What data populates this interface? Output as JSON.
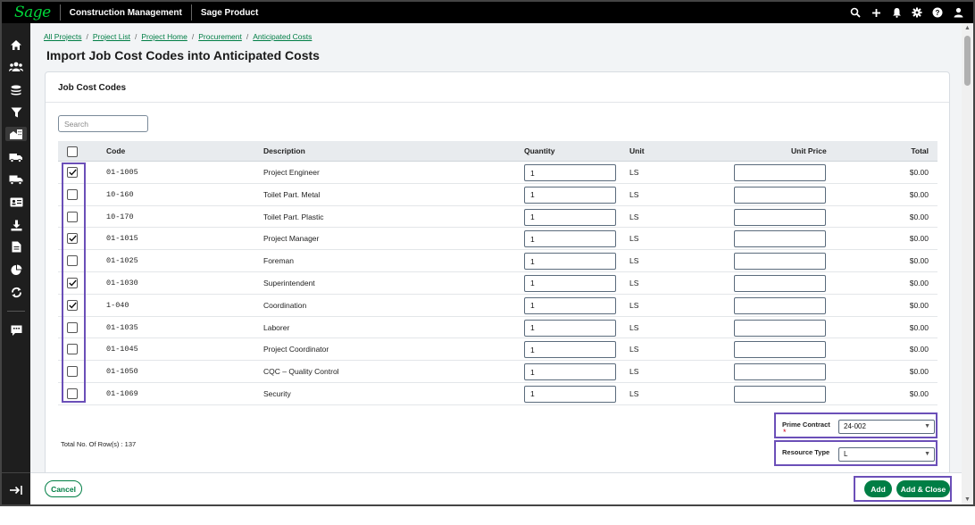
{
  "topbar": {
    "logo": "Sage",
    "app_name": "Construction Management",
    "product_name": "Sage Product",
    "icons": [
      "search-icon",
      "plus-icon",
      "bell-icon",
      "gear-icon",
      "help-icon",
      "user-icon"
    ]
  },
  "sidebar": {
    "icons": [
      "home-icon",
      "people-icon",
      "stack-icon",
      "filter-icon",
      "building-icon",
      "truck-dollar-icon",
      "truck-icon",
      "id-card-icon",
      "download-icon",
      "document-icon",
      "pie-chart-icon",
      "sync-icon",
      "feedback-icon"
    ],
    "active_index": 4
  },
  "breadcrumb": [
    "All Projects",
    "Project List",
    "Project Home",
    "Procurement",
    "Anticipated Costs"
  ],
  "page_title": "Import Job Cost Codes into Anticipated Costs",
  "card": {
    "title": "Job Cost Codes",
    "search_placeholder": "Search"
  },
  "table": {
    "columns": [
      "Code",
      "Description",
      "Quantity",
      "Unit",
      "Unit Price",
      "Total"
    ],
    "rows": [
      {
        "checked": true,
        "code": "01-1005",
        "description": "Project Engineer",
        "quantity": "1",
        "unit": "LS",
        "unit_price": "",
        "total": "$0.00"
      },
      {
        "checked": false,
        "code": "10-160",
        "description": "Toilet Part. Metal",
        "quantity": "1",
        "unit": "LS",
        "unit_price": "",
        "total": "$0.00"
      },
      {
        "checked": false,
        "code": "10-170",
        "description": "Toilet Part. Plastic",
        "quantity": "1",
        "unit": "LS",
        "unit_price": "",
        "total": "$0.00"
      },
      {
        "checked": true,
        "code": "01-1015",
        "description": "Project Manager",
        "quantity": "1",
        "unit": "LS",
        "unit_price": "",
        "total": "$0.00"
      },
      {
        "checked": false,
        "code": "01-1025",
        "description": "Foreman",
        "quantity": "1",
        "unit": "LS",
        "unit_price": "",
        "total": "$0.00"
      },
      {
        "checked": true,
        "code": "01-1030",
        "description": "Superintendent",
        "quantity": "1",
        "unit": "LS",
        "unit_price": "",
        "total": "$0.00"
      },
      {
        "checked": true,
        "code": "1-040",
        "description": "Coordination",
        "quantity": "1",
        "unit": "LS",
        "unit_price": "",
        "total": "$0.00"
      },
      {
        "checked": false,
        "code": "01-1035",
        "description": "Laborer",
        "quantity": "1",
        "unit": "LS",
        "unit_price": "",
        "total": "$0.00"
      },
      {
        "checked": false,
        "code": "01-1045",
        "description": "Project Coordinator",
        "quantity": "1",
        "unit": "LS",
        "unit_price": "",
        "total": "$0.00"
      },
      {
        "checked": false,
        "code": "01-1050",
        "description": "CQC – Quality Control",
        "quantity": "1",
        "unit": "LS",
        "unit_price": "",
        "total": "$0.00"
      },
      {
        "checked": false,
        "code": "01-1069",
        "description": "Security",
        "quantity": "1",
        "unit": "LS",
        "unit_price": "",
        "total": "$0.00"
      }
    ]
  },
  "total_rows_label": "Total No. Of Row(s) : 137",
  "prime_contract": {
    "label": "Prime Contract",
    "required_mark": "*",
    "value": "24-002"
  },
  "resource_type": {
    "label": "Resource Type",
    "value": "L"
  },
  "footer": {
    "cancel_label": "Cancel",
    "add_label": "Add",
    "add_close_label": "Add & Close"
  },
  "colors": {
    "brand_green": "#007e45",
    "logo_green": "#00d639",
    "highlight_purple": "#6b4fb8"
  }
}
